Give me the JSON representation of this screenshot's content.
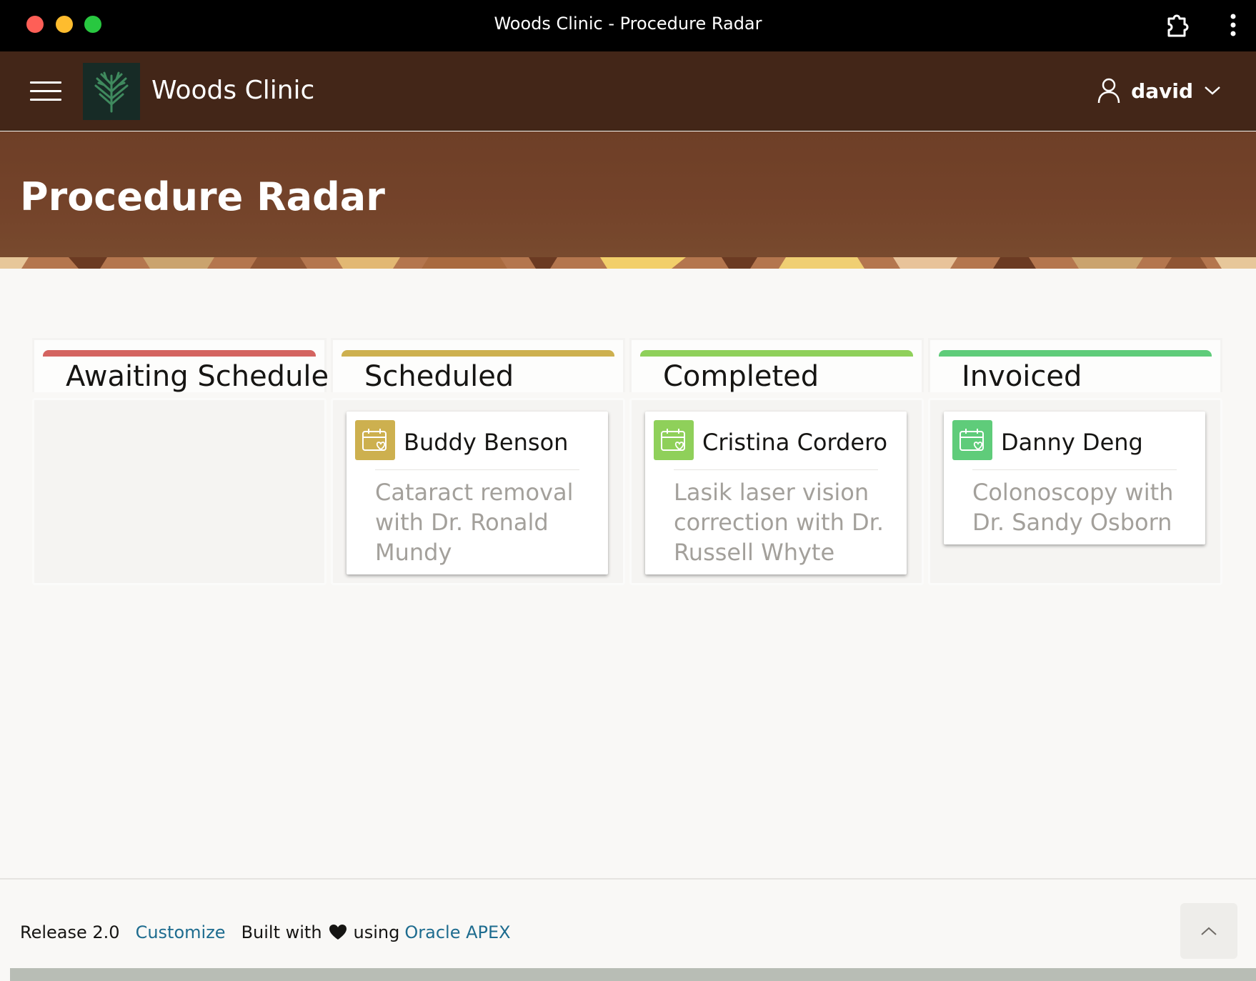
{
  "window": {
    "title": "Woods Clinic - Procedure Radar",
    "icons": [
      "extension-icon",
      "kebab-menu-icon"
    ]
  },
  "header": {
    "brand": "Woods Clinic",
    "user": "david",
    "icons": [
      "hamburger-icon",
      "tree-logo-icon",
      "user-icon",
      "chevron-down-icon"
    ]
  },
  "page": {
    "title": "Procedure Radar"
  },
  "board": {
    "columns": [
      {
        "title": "Awaiting Schedule",
        "color": "#d46460",
        "cards": []
      },
      {
        "title": "Scheduled",
        "color": "#cdb04f",
        "cards": [
          {
            "name": "Buddy Benson",
            "description": "Cataract removal with Dr. Ronald Mundy",
            "icon": "calendar-heart-icon"
          }
        ]
      },
      {
        "title": "Completed",
        "color": "#8fd05a",
        "cards": [
          {
            "name": "Cristina Cordero",
            "description": "Lasik laser vision correction with Dr. Russell Whyte",
            "icon": "calendar-heart-icon"
          }
        ]
      },
      {
        "title": "Invoiced",
        "color": "#5fcc7a",
        "cards": [
          {
            "name": "Danny Deng",
            "description": "Colonoscopy with Dr. Sandy Osborn",
            "icon": "calendar-heart-icon"
          }
        ]
      }
    ]
  },
  "footer": {
    "release": "Release 2.0",
    "customize": "Customize",
    "built_with": "Built with",
    "using": "using",
    "apex_link": "Oracle APEX",
    "icons": [
      "heart-icon",
      "chevron-up-icon"
    ]
  },
  "colors": {
    "titlebar": "#000000",
    "header": "#432618",
    "hero": "#74432a",
    "link": "#1e6c8f"
  }
}
